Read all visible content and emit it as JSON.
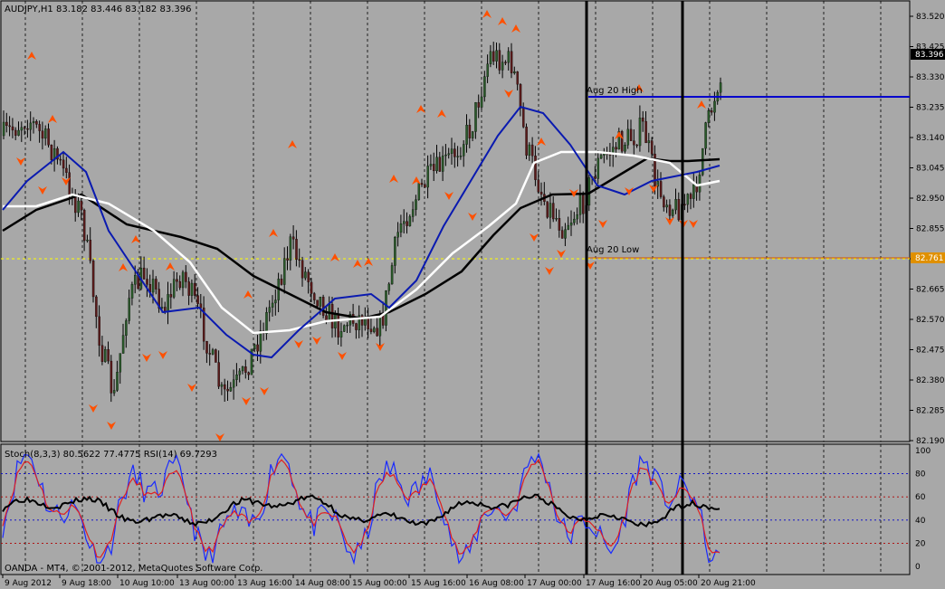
{
  "chart": {
    "symbol_label": "AUDJPY,H1  83.182 83.446 83.182 83.396",
    "copyright": "OANDA - MT4, © 2001-2012, MetaQuotes Software Corp.",
    "annotations": {
      "high": "Aug 20 High",
      "low": "Aug 20 Low"
    },
    "price_axis": [
      "83.520",
      "83.425",
      "83.330",
      "83.235",
      "83.140",
      "83.045",
      "82.950",
      "82.855",
      "82.760",
      "82.665",
      "82.570",
      "82.475",
      "82.380",
      "82.285",
      "82.190"
    ],
    "current_price": "83.396",
    "level_price": "82.761",
    "time_axis": [
      "9 Aug 2012",
      "9 Aug 18:00",
      "10 Aug 10:00",
      "13 Aug 00:00",
      "13 Aug 16:00",
      "14 Aug 08:00",
      "15 Aug 00:00",
      "15 Aug 16:00",
      "16 Aug 08:00",
      "17 Aug 00:00",
      "17 Aug 16:00",
      "20 Aug 05:00",
      "20 Aug 21:00"
    ]
  },
  "indicator": {
    "label": "Stoch(8,3,3) 80.5622 77.4775  RSI(14) 69.7293",
    "scale": [
      "100",
      "80",
      "60",
      "40",
      "20",
      "0"
    ]
  },
  "colors": {
    "background": "#a8a8a8",
    "bull": "#2a5a2a",
    "bear": "#5a1a1a",
    "ma_blue": "#0a1ab0",
    "ma_white": "#ffffff",
    "ma_black": "#000000",
    "level_line": "#0000cc",
    "yellow_line": "#ffff00",
    "current_tag": "#000000",
    "level_tag": "#e09000",
    "fractal": "#ff5000"
  }
}
